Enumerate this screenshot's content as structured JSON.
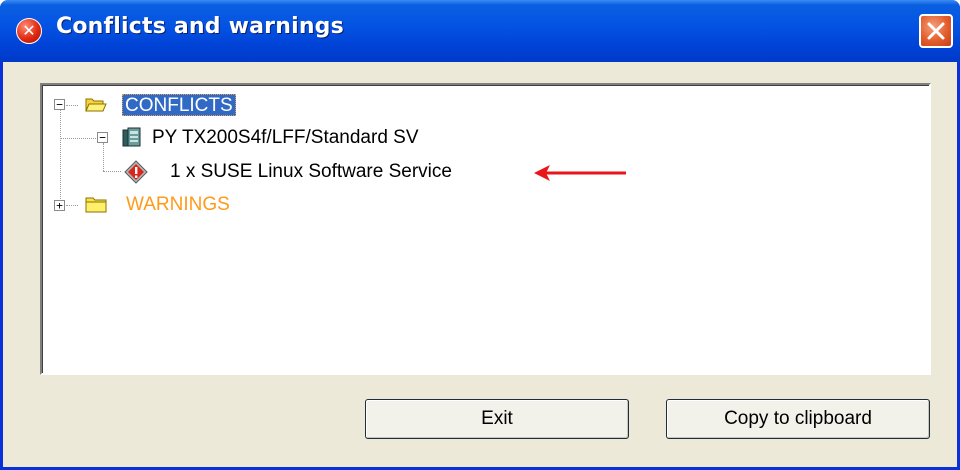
{
  "window": {
    "title": "Conflicts and warnings"
  },
  "tree": {
    "conflicts_label": "CONFLICTS",
    "server_label": "PY TX200S4f/LFF/Standard SV",
    "service_label": "1 x SUSE Linux Software Service",
    "warnings_label": "WARNINGS",
    "expander_minus": "−",
    "expander_plus": "+"
  },
  "buttons": {
    "exit": "Exit",
    "copy": "Copy to clipboard"
  },
  "colors": {
    "titlebar": "#0454e4",
    "selection": "#316ac5",
    "warnings_text": "#ff9a1a",
    "annotation_arrow": "#e8161a"
  },
  "icons": [
    "error-icon",
    "close-icon",
    "open-folder-icon",
    "server-icon",
    "conflict-diamond-icon",
    "folder-icon",
    "red-arrow-annotation"
  ]
}
